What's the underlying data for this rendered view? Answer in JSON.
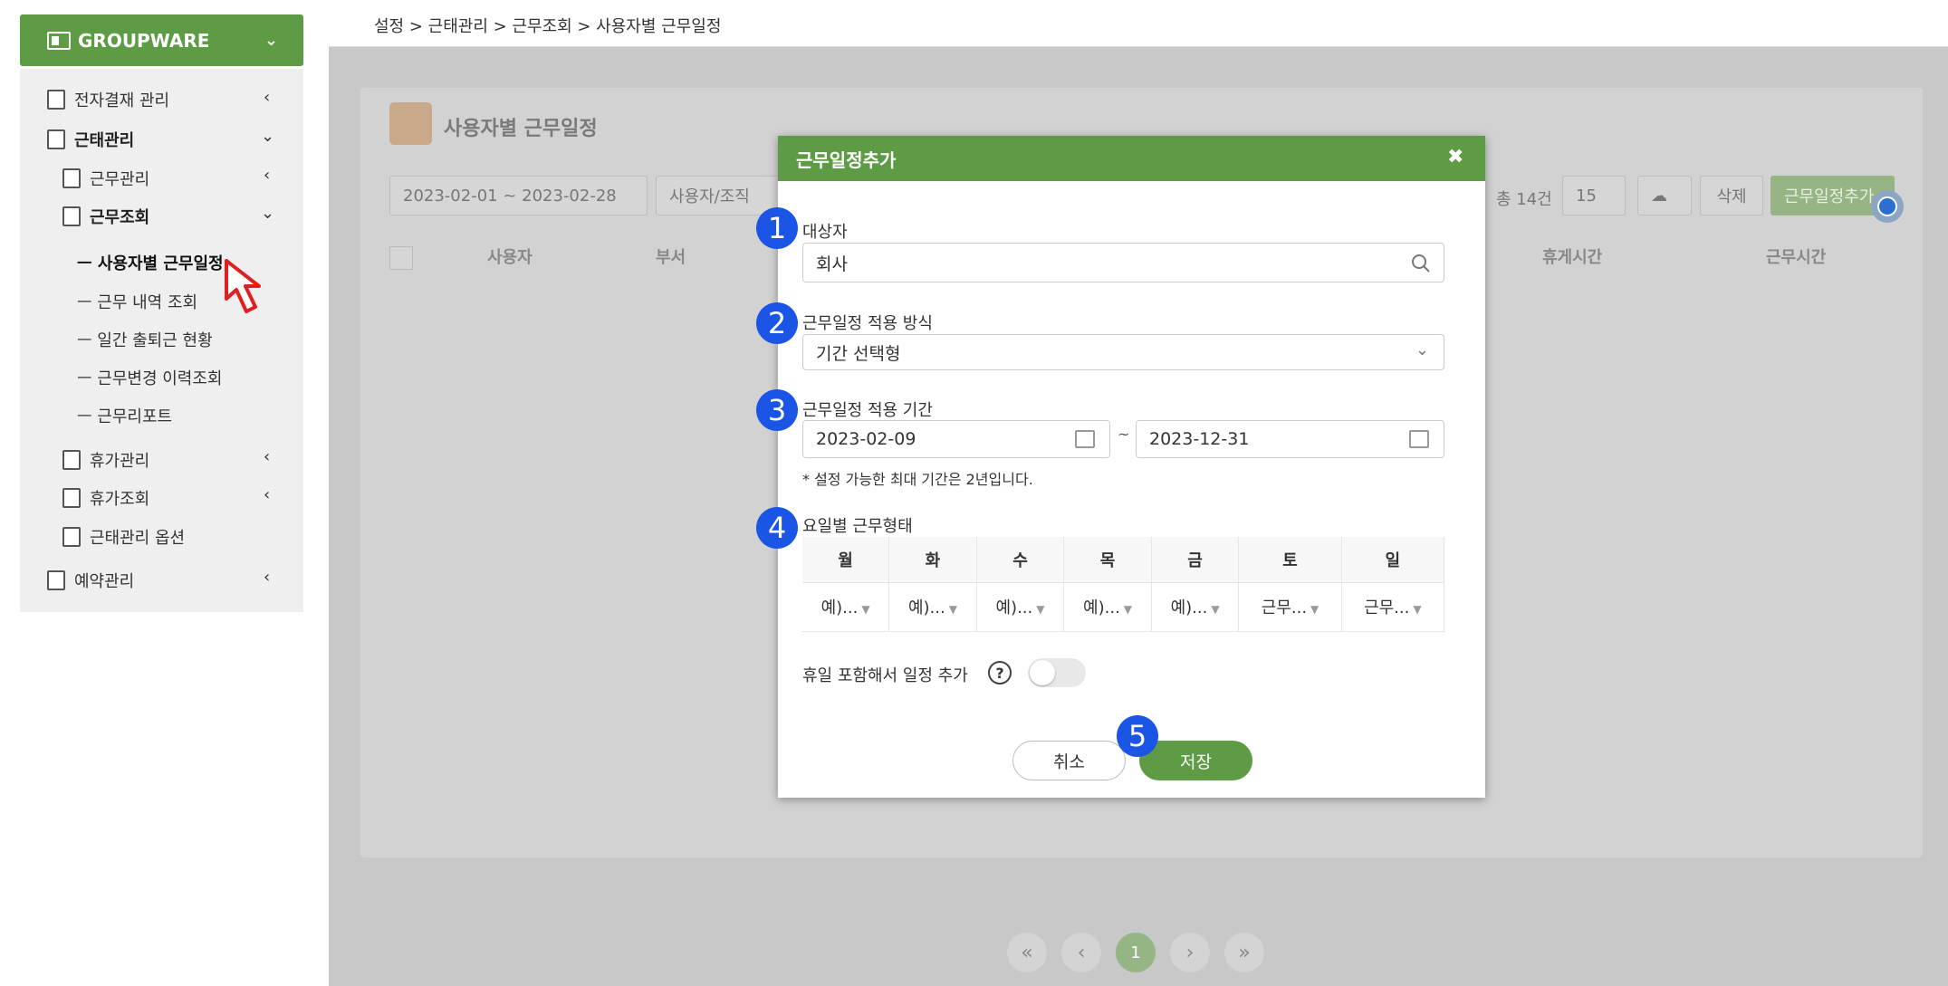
{
  "sidebar": {
    "header": "GROUPWARE",
    "items": [
      {
        "label": "전자결재 관리"
      },
      {
        "label": "근태관리"
      },
      {
        "label": "근무관리"
      },
      {
        "label": "근무조회"
      },
      {
        "label": "휴가관리"
      },
      {
        "label": "휴가조회"
      },
      {
        "label": "근태관리 옵션"
      },
      {
        "label": "예약관리"
      }
    ],
    "subitems": [
      {
        "label": "ㅡ 사용자별 근무일정"
      },
      {
        "label": "ㅡ 근무 내역 조회"
      },
      {
        "label": "ㅡ 일간 출퇴근 현황"
      },
      {
        "label": "ㅡ 근무변경 이력조회"
      },
      {
        "label": "ㅡ 근무리포트"
      }
    ]
  },
  "breadcrumb": "설정 > 근태관리 > 근무조회 > 사용자별 근무일정",
  "card": {
    "title": "사용자별 근무일정",
    "date_range": "2023-02-01 ~ 2023-02-28",
    "user_placeholder": "사용자/조직",
    "total": "총 14건",
    "page_size": "15",
    "delete_label": "삭제",
    "add_label": "근무일정추가",
    "headers": [
      "사용자",
      "부서",
      "휴게시간",
      "근무시간"
    ]
  },
  "pagination": {
    "first": "«",
    "prev": "‹",
    "current": "1",
    "next": "›",
    "last": "»"
  },
  "modal": {
    "title": "근무일정추가",
    "close": "✖",
    "target_label": "대상자",
    "target_value": "회사",
    "method_label": "근무일정 적용 방식",
    "method_value": "기간 선택형",
    "period_label": "근무일정 적용 기간",
    "start_date": "2023-02-09",
    "tilde": "~",
    "end_date": "2023-12-31",
    "period_note": "* 설정 가능한 최대 기간은 2년입니다.",
    "weekday_label": "요일별 근무형태",
    "days": [
      "월",
      "화",
      "수",
      "목",
      "금",
      "토",
      "일"
    ],
    "day_values": [
      "예)...",
      "예)...",
      "예)...",
      "예)...",
      "예)...",
      "근무...",
      "근무..."
    ],
    "holiday_label": "휴일 포함해서 일정 추가",
    "help": "?",
    "cancel": "취소",
    "save": "저장"
  },
  "badges": [
    "1",
    "2",
    "3",
    "4",
    "5"
  ],
  "colors": {
    "brand_green": "#5d9b45",
    "badge_blue": "#1a55e6",
    "cursor_red": "#e02020"
  }
}
